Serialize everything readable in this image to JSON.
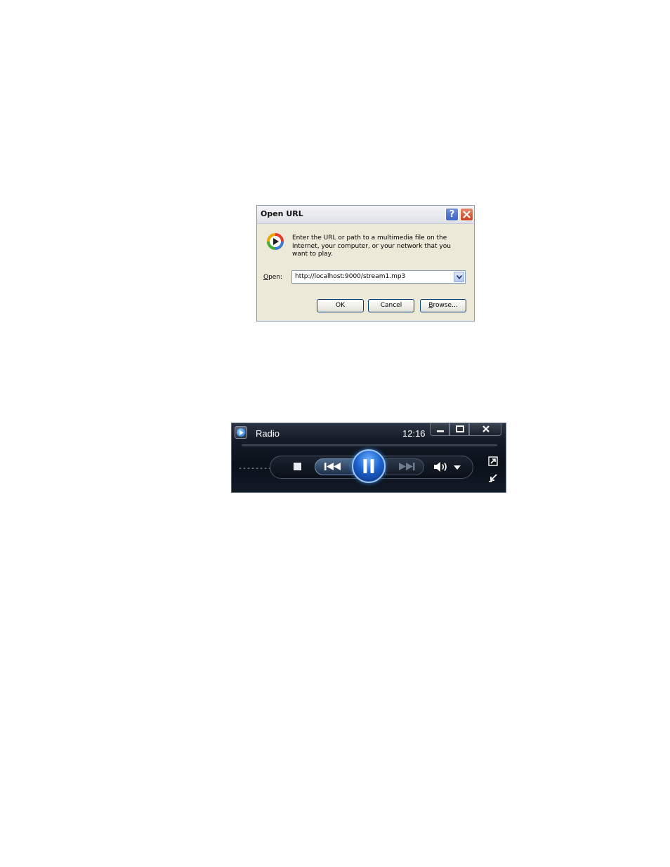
{
  "dialog": {
    "title": "Open URL",
    "help_icon": "help-icon",
    "close_icon": "close-icon",
    "app_icon": "windows-media-player-icon",
    "message": "Enter the URL or path to a multimedia file on the Internet, your computer, or your network that you want to play.",
    "open_label_mnemonic": "O",
    "open_label_rest": "pen:",
    "url_value": "http://localhost:9000/stream1.mp3",
    "dropdown_icon": "chevron-down-icon",
    "ok_label": "OK",
    "cancel_label": "Cancel",
    "browse_label_mnemonic": "B",
    "browse_label_rest": "rowse..."
  },
  "player": {
    "title": "Radio",
    "time": "12:16",
    "status": "-----------",
    "icons": {
      "app": "windows-media-player-icon",
      "minimize": "minimize-icon",
      "maximize": "maximize-icon",
      "close": "close-icon",
      "stop": "stop-icon",
      "previous": "previous-icon",
      "play_pause": "pause-icon",
      "next": "next-icon",
      "volume": "volume-icon",
      "volume_menu": "chevron-down-icon",
      "expand": "switch-to-library-icon",
      "restore": "restore-mini-icon"
    },
    "colors": {
      "frame": "#141b26",
      "accent": "#1d63cf",
      "text": "#ffffff"
    }
  }
}
